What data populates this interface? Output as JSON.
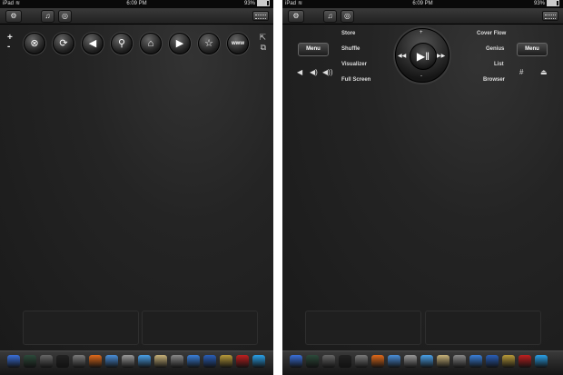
{
  "status": {
    "carrier": "iPad",
    "time": "6:09 PM",
    "battery": "93%"
  },
  "left": {
    "nav_buttons": [
      {
        "name": "close-icon",
        "glyph": "⊗"
      },
      {
        "name": "refresh-icon",
        "glyph": "⟳"
      },
      {
        "name": "back-icon",
        "glyph": "◀"
      },
      {
        "name": "search-icon",
        "glyph": "⚲"
      },
      {
        "name": "home-icon",
        "glyph": "⌂"
      },
      {
        "name": "forward-icon",
        "glyph": "▶"
      },
      {
        "name": "star-icon",
        "glyph": "☆"
      },
      {
        "name": "www-icon",
        "glyph": "www"
      }
    ],
    "plus": "+",
    "minus": "-"
  },
  "right": {
    "menu_left": "Menu",
    "menu_right": "Menu",
    "labels_left": [
      "Store",
      "Shuffle",
      "Visualizer",
      "Full Screen"
    ],
    "labels_right": [
      "Cover Flow",
      "Genius",
      "List",
      "Browser"
    ],
    "wheel_plus": "+",
    "wheel_minus": "-",
    "play_glyph": "▶‖",
    "prev_glyph": "◀◀",
    "next_glyph": "▶▶"
  },
  "dock_colors": [
    "#3a6fd8",
    "#2c4a3a",
    "#666",
    "#222",
    "#7a7a7a",
    "#e06a1b",
    "#4a8fd8",
    "#999",
    "#4aa0e8",
    "#c8b27a",
    "#888",
    "#3a7fd8",
    "#2a5fb8",
    "#b89a3a",
    "#c02020",
    "#2aa0e8"
  ]
}
